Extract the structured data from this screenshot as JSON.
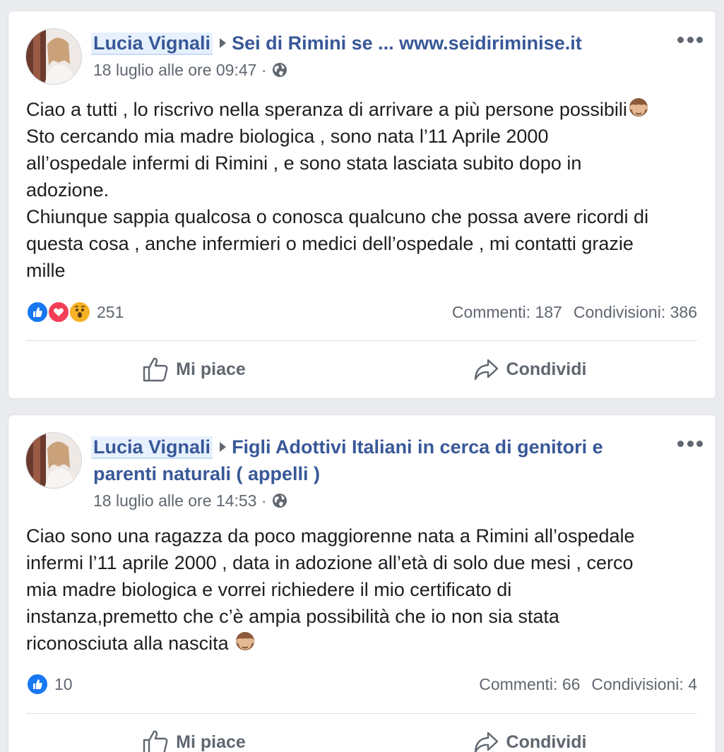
{
  "posts": [
    {
      "author": "Lucia Vignali",
      "group": "Sei di Rimini se ... www.seidiriminise.it",
      "timestamp": "18 luglio alle ore 09:47 ·",
      "privacy_icon": "globe-icon",
      "text_lines": [
        "Ciao a tutti , lo riscrivo nella speranza di arrivare a più persone possibili",
        "Sto cercando mia madre biologica , sono nata l’11 Aprile 2000",
        "all’ospedale infermi di Rimini , e sono stata lasciata subito dopo in",
        "adozione.",
        "Chiunque sappia qualcosa o conosca qualcuno che possa avere ricordi di",
        "questa cosa , anche infermieri o medici dell’ospedale , mi contatti grazie",
        "mille"
      ],
      "reactions": [
        "like",
        "love",
        "wow"
      ],
      "reaction_count": "251",
      "comments": "Commenti: 187",
      "shares": "Condivisioni: 386",
      "like_label": "Mi piace",
      "share_label": "Condividi"
    },
    {
      "author": "Lucia Vignali",
      "group": "Figli Adottivi Italiani in cerca di genitori e parenti naturali ( appelli )",
      "timestamp": "18 luglio alle ore 14:53 ·",
      "privacy_icon": "globe-icon",
      "text_lines": [
        "Ciao sono una ragazza da poco maggiorenne nata a Rimini all’ospedale",
        "infermi l’11 aprile 2000 , data in adozione all’età di solo due mesi , cerco",
        "mia madre biologica e vorrei richiedere il mio certificato di",
        "instanza,premetto che c’è ampia possibilità che io non sia stata",
        "riconosciuta alla nascita"
      ],
      "reactions": [
        "like"
      ],
      "reaction_count": "10",
      "comments": "Commenti: 66",
      "shares": "Condivisioni: 4",
      "like_label": "Mi piace",
      "share_label": "Condividi"
    }
  ],
  "colors": {
    "link": "#385898",
    "meta": "#606770",
    "like": "#1877f2",
    "love": "#f33e58",
    "wow": "#f7b125"
  }
}
